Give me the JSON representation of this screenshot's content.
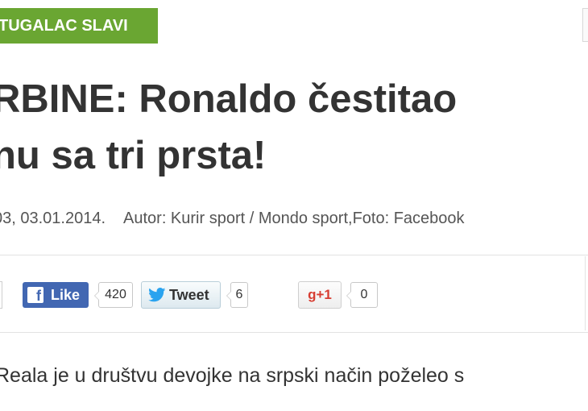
{
  "category_tag": "TUGALAC SLAVI",
  "headline": {
    "line1": "RBINE: Ronaldo čestitao",
    "line2": "nu sa tri prsta!"
  },
  "meta": {
    "date": "03, 03.01.2014.",
    "author": "Autor: Kurir sport / Mondo sport,Foto: Facebook"
  },
  "share": {
    "facebook_label": "Like",
    "facebook_count": "420",
    "twitter_label": "Tweet",
    "twitter_count": "6",
    "gplus_label": "g+1",
    "gplus_count": "0"
  },
  "body_snippet": "Reala je u društvu devojke na srpski način poželeo s",
  "colors": {
    "tag_green": "#6aa632",
    "facebook_blue": "#4267b2",
    "twitter_blue": "#2aa3ef",
    "gplus_red": "#d73d32"
  },
  "icons": [
    "facebook-icon",
    "twitter-bird-icon"
  ]
}
